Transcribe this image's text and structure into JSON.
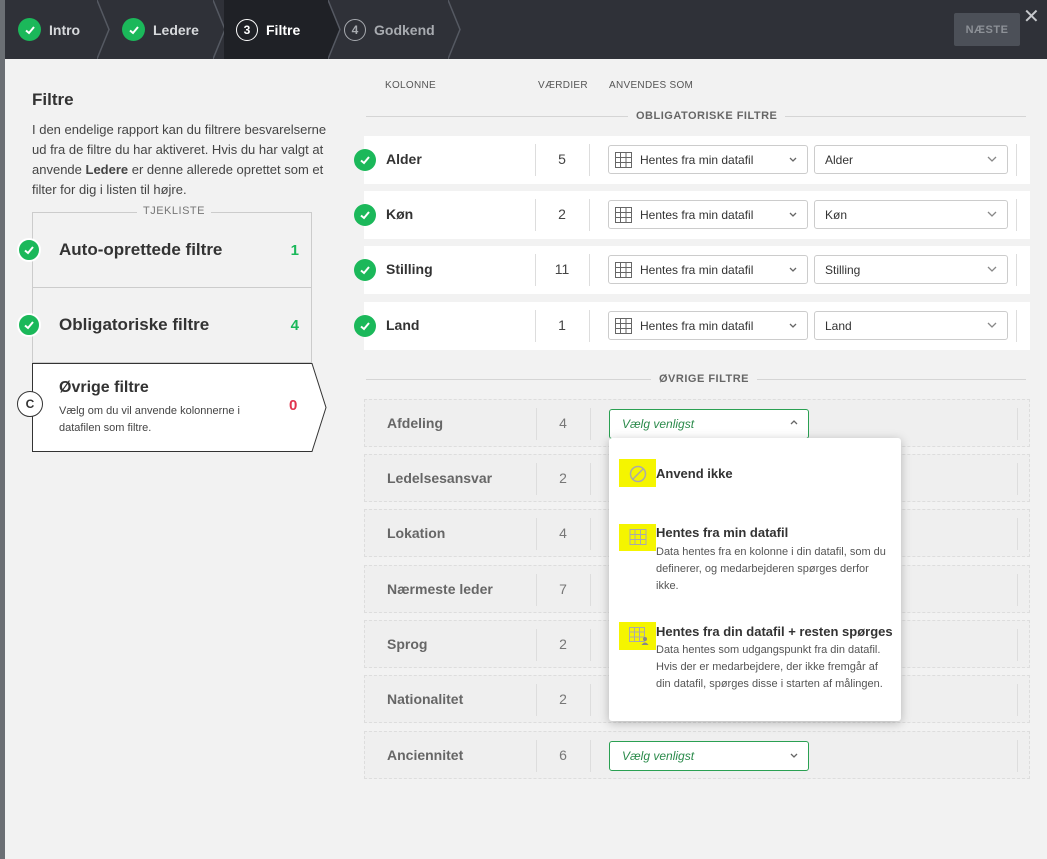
{
  "steps": [
    {
      "label": "Intro",
      "state": "done"
    },
    {
      "label": "Ledere",
      "state": "done"
    },
    {
      "number": "3",
      "label": "Filtre",
      "state": "active"
    },
    {
      "number": "4",
      "label": "Godkend",
      "state": "pending"
    }
  ],
  "next_button": "NÆSTE",
  "close_glyph": "✕",
  "left": {
    "title": "Filtre",
    "desc_1": "I den endelige rapport kan du filtrere besvarelserne ud fra de filtre du har aktiveret. Hvis du har valgt at anvende ",
    "desc_bold": "Ledere",
    "desc_2": " er denne allerede oprettet som et filter for dig i listen til højre.",
    "checklist_label": "TJEKLISTE",
    "items": [
      {
        "title": "Auto-oprettede filtre",
        "count": "1",
        "count_color": "#1bb85a"
      },
      {
        "title": "Obligatoriske filtre",
        "count": "4",
        "count_color": "#1bb85a"
      }
    ],
    "active_item": {
      "marker": "C",
      "title": "Øvrige filtre",
      "sub": "Vælg om du vil anvende kolonnerne i datafilen som filtre.",
      "count": "0",
      "count_color": "#e0344e"
    }
  },
  "columns": {
    "kolonne": "KOLONNE",
    "vaerdier": "VÆRDIER",
    "anvendes": "ANVENDES SOM"
  },
  "sections": {
    "mandatory": "OBLIGATORISKE FILTRE",
    "other": "ØVRIGE FILTRE"
  },
  "mandatory_rows": [
    {
      "name": "Alder",
      "values": "5",
      "source": "Hentes fra min datafil",
      "column": "Alder"
    },
    {
      "name": "Køn",
      "values": "2",
      "source": "Hentes fra min datafil",
      "column": "Køn"
    },
    {
      "name": "Stilling",
      "values": "11",
      "source": "Hentes fra min datafil",
      "column": "Stilling"
    },
    {
      "name": "Land",
      "values": "1",
      "source": "Hentes fra min datafil",
      "column": "Land"
    }
  ],
  "other_rows": [
    {
      "name": "Afdeling",
      "values": "4",
      "select": "Vælg venligst"
    },
    {
      "name": "Ledelsesansvar",
      "values": "2"
    },
    {
      "name": "Lokation",
      "values": "4"
    },
    {
      "name": "Nærmeste leder",
      "values": "7"
    },
    {
      "name": "Sprog",
      "values": "2"
    },
    {
      "name": "Nationalitet",
      "values": "2"
    },
    {
      "name": "Anciennitet",
      "values": "6",
      "select": "Vælg venligst"
    }
  ],
  "dropdown": {
    "options": [
      {
        "title": "Anvend ikke",
        "desc": "",
        "icon": "ban-icon"
      },
      {
        "title": "Hentes fra min datafil",
        "desc": "Data hentes fra en kolonne i din datafil, som du definerer, og medarbejderen spørges derfor ikke.",
        "icon": "grid-icon"
      },
      {
        "title": "Hentes fra din datafil + resten spørges",
        "desc": "Data hentes som udgangspunkt fra din datafil. Hvis der er medarbejdere, der ikke fremgår af din datafil, spørges disse i starten af målingen.",
        "icon": "grid-person-icon"
      }
    ],
    "highlight_color": "#f5f500"
  }
}
